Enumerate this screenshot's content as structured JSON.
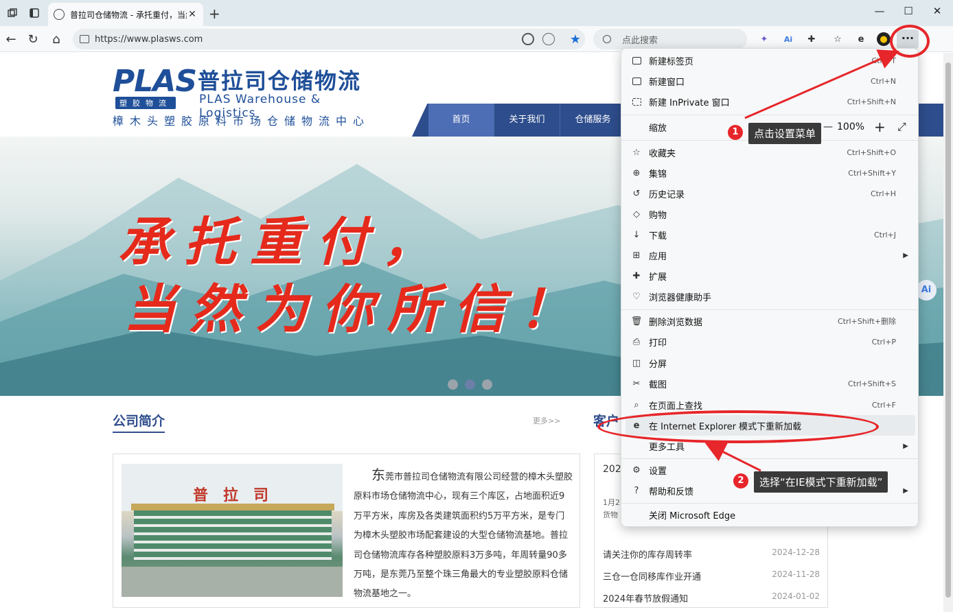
{
  "browser": {
    "tab_title": "普拉司仓储物流 - 承托重付，当然",
    "url": "https://www.plasws.com",
    "search_placeholder": "点此搜索",
    "menu_button": "···"
  },
  "site": {
    "logo_plas": "PLAS",
    "logo_sub": "塑胶物流",
    "logo_cn": "普拉司仓储物流",
    "logo_en": "PLAS Warehouse & Logistics",
    "logo_slogan": "樟木头塑胶原料市场仓储物流中心",
    "nav": [
      "首页",
      "关于我们",
      "仓储服务"
    ],
    "banner_line1": "承托重付，",
    "banner_line2": "当然为你所信！",
    "section_intro": "公司简介",
    "section_more": "更多>>",
    "section_news_partial": "客户",
    "intro_sign": "普拉司",
    "intro_first_char": "东",
    "intro_text": "莞市普拉司仓储物流有限公司经营的樟木头塑胶原料市场仓储物流中心，现有三个库区，占地面积近9万平方米，库房及各类建筑面积约5万平方米，是专门为樟木头塑胶市场配套建设的大型仓储物流基地。普拉司仓储物流库存各种塑胶原料3万多吨，年周转量90多万吨，是东莞乃至整个珠三角最大的专业塑胶原料仓储物流基地之一。",
    "news_top": "2025",
    "news_sub1": "1月2",
    "news_sub2": "货物",
    "news": [
      {
        "title": "请关注你的库存周转率",
        "date": "2024-12-28"
      },
      {
        "title": "三仓一仓同移库作业开通",
        "date": "2024-11-28"
      },
      {
        "title": "2024年春节放假通知",
        "date": "2024-01-02"
      }
    ],
    "ai_float": "Ai"
  },
  "menu": {
    "items": [
      {
        "label": "新建标签页",
        "shortcut": "Ctrl+T",
        "icon": "new-tab-icon"
      },
      {
        "label": "新建窗口",
        "shortcut": "Ctrl+N",
        "icon": "window-icon"
      },
      {
        "label": "新建 InPrivate 窗口",
        "shortcut": "Ctrl+Shift+N",
        "icon": "inprivate-icon"
      },
      {
        "label": "缩放",
        "shortcut": "",
        "icon": ""
      },
      {
        "label": "收藏夹",
        "shortcut": "Ctrl+Shift+O",
        "icon": "favorites-icon"
      },
      {
        "label": "集锦",
        "shortcut": "Ctrl+Shift+Y",
        "icon": "collections-icon"
      },
      {
        "label": "历史记录",
        "shortcut": "Ctrl+H",
        "icon": "history-icon"
      },
      {
        "label": "购物",
        "shortcut": "",
        "icon": "shopping-icon"
      },
      {
        "label": "下载",
        "shortcut": "Ctrl+J",
        "icon": "download-icon"
      },
      {
        "label": "应用",
        "shortcut": "",
        "icon": "apps-icon"
      },
      {
        "label": "扩展",
        "shortcut": "",
        "icon": "extensions-icon"
      },
      {
        "label": "浏览器健康助手",
        "shortcut": "",
        "icon": "health-icon"
      },
      {
        "label": "删除浏览数据",
        "shortcut": "Ctrl+Shift+删除",
        "icon": "delete-icon"
      },
      {
        "label": "打印",
        "shortcut": "Ctrl+P",
        "icon": "print-icon"
      },
      {
        "label": "分屏",
        "shortcut": "",
        "icon": "split-screen-icon"
      },
      {
        "label": "截图",
        "shortcut": "Ctrl+Shift+S",
        "icon": "screenshot-icon"
      },
      {
        "label": "在页面上查找",
        "shortcut": "Ctrl+F",
        "icon": "find-icon"
      },
      {
        "label": "在 Internet Explorer 模式下重新加载",
        "shortcut": "",
        "icon": "ie-icon"
      },
      {
        "label": "更多工具",
        "shortcut": "",
        "icon": ""
      },
      {
        "label": "设置",
        "shortcut": "",
        "icon": "settings-icon"
      },
      {
        "label": "帮助和反馈",
        "shortcut": "",
        "icon": "help-icon"
      },
      {
        "label": "关闭 Microsoft Edge",
        "shortcut": "",
        "icon": ""
      }
    ],
    "zoom_value": "100%",
    "zoom_minus": "—",
    "zoom_plus": "+"
  },
  "annotations": {
    "step1_num": "1",
    "step1_text": "点击设置菜单",
    "step2_num": "2",
    "step2_text": "选择“在IE模式下重新加载”",
    "color": "#e6262a"
  }
}
